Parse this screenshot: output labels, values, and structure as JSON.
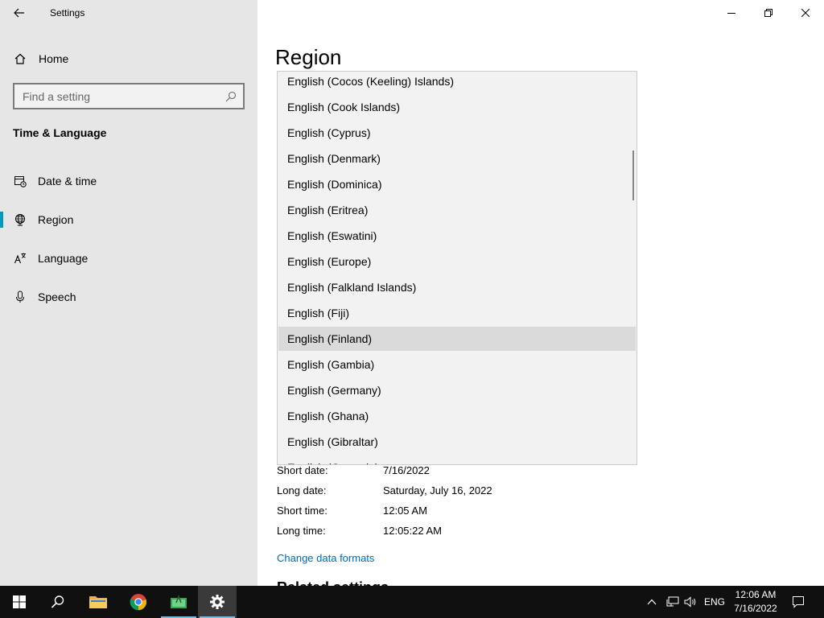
{
  "window": {
    "title": "Settings"
  },
  "sidebar": {
    "home_label": "Home",
    "search_placeholder": "Find a setting",
    "section_title": "Time & Language",
    "items": [
      {
        "label": "Date & time",
        "icon": "calendar-clock-icon"
      },
      {
        "label": "Region",
        "icon": "globe-icon",
        "active": true
      },
      {
        "label": "Language",
        "icon": "language-icon"
      },
      {
        "label": "Speech",
        "icon": "microphone-icon"
      }
    ]
  },
  "main": {
    "title": "Region",
    "dropdown": {
      "options": [
        "English (Cocos (Keeling) Islands)",
        "English (Cook Islands)",
        "English (Cyprus)",
        "English (Denmark)",
        "English (Dominica)",
        "English (Eritrea)",
        "English (Eswatini)",
        "English (Europe)",
        "English (Falkland Islands)",
        "English (Fiji)",
        "English (Finland)",
        "English (Gambia)",
        "English (Germany)",
        "English (Ghana)",
        "English (Gibraltar)",
        "English (Grenada)"
      ],
      "highlighted": "English (Finland)"
    },
    "formats": [
      {
        "label": "Short date:",
        "value": "7/16/2022"
      },
      {
        "label": "Long date:",
        "value": "Saturday, July 16, 2022"
      },
      {
        "label": "Short time:",
        "value": "12:05 AM"
      },
      {
        "label": "Long time:",
        "value": "12:05:22 AM"
      }
    ],
    "change_link": "Change data formats",
    "related_heading": "Related settings"
  },
  "taskbar": {
    "language": "ENG",
    "time": "12:06 AM",
    "date": "7/16/2022",
    "accent": "#0099bc"
  }
}
